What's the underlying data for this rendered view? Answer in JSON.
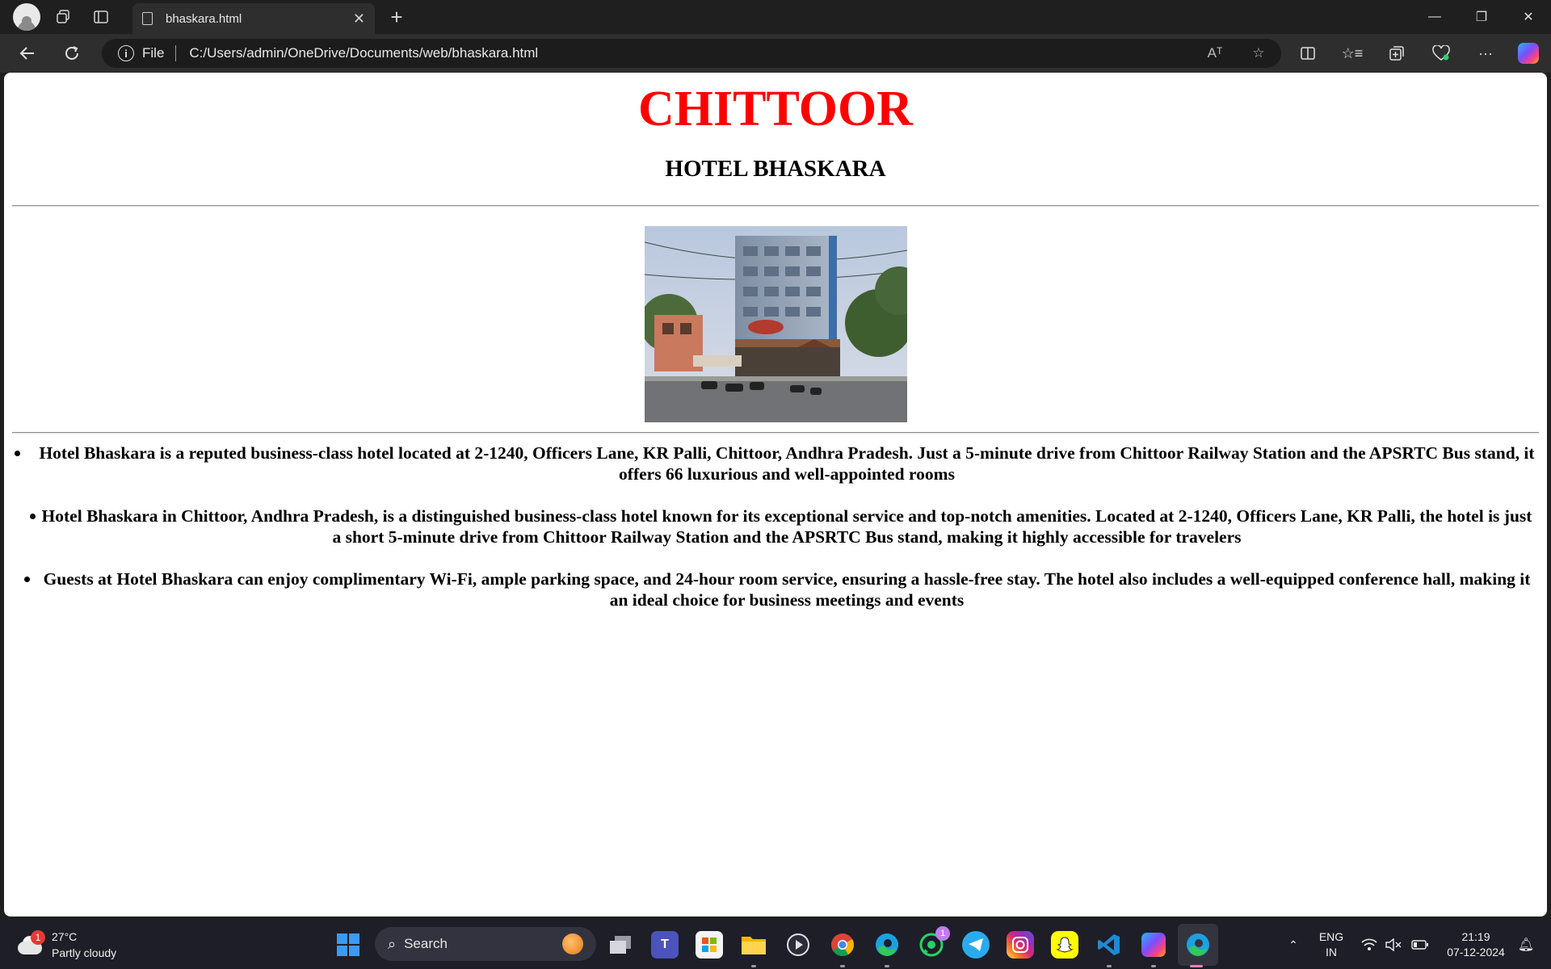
{
  "browser": {
    "tab_title": "bhaskara.html",
    "tab_close": "✕",
    "new_tab": "+",
    "address_scheme": "File",
    "address_url": "C:/Users/admin/OneDrive/Documents/web/bhaskara.html",
    "read_aloud": "Aᵀ",
    "minimize": "—",
    "restore": "❐",
    "close": "✕",
    "more": "···"
  },
  "page": {
    "city": "CHITTOOR",
    "hotel": "HOTEL BHASKARA",
    "bullets": [
      "Hotel Bhaskara is a reputed business-class hotel located at 2-1240, Officers Lane, KR Palli, Chittoor, Andhra Pradesh. Just a 5-minute drive from Chittoor Railway Station and the APSRTC Bus stand, it offers 66 luxurious and well-appointed rooms",
      "Hotel Bhaskara in Chittoor, Andhra Pradesh, is a distinguished business-class hotel known for its exceptional service and top-notch amenities. Located at 2-1240, Officers Lane, KR Palli, the hotel is just a short 5-minute drive from Chittoor Railway Station and the APSRTC Bus stand, making it highly accessible for travelers",
      "Guests at Hotel Bhaskara can enjoy complimentary Wi-Fi, ample parking space, and 24-hour room service, ensuring a hassle-free stay. The hotel also includes a well-equipped conference hall, making it an ideal choice for business meetings and events"
    ]
  },
  "taskbar": {
    "weather_temp": "27°C",
    "weather_desc": "Partly cloudy",
    "weather_badge": "1",
    "search_label": "Search",
    "whatsapp_badge": "1",
    "language_line1": "ENG",
    "language_line2": "IN",
    "time": "21:19",
    "date": "07-12-2024"
  },
  "colors": {
    "city_heading": "#ff0000",
    "chrome_bg": "#1f1f1f",
    "toolbar_bg": "#2e2e2e",
    "page_bg": "#ffffff",
    "taskbar_bg": "#1e1e28"
  },
  "icons": [
    "profile-icon",
    "workspaces-icon",
    "vertical-tabs-icon",
    "page-icon",
    "back-icon",
    "refresh-icon",
    "info-icon",
    "read-aloud-icon",
    "favorite-star-icon",
    "split-screen-icon",
    "favorites-icon",
    "collections-icon",
    "browser-essentials-icon",
    "more-icon",
    "copilot-icon",
    "weather-icon",
    "windows-start-icon",
    "search-icon",
    "task-view-icon",
    "teams-icon",
    "store-icon",
    "file-explorer-icon",
    "media-player-icon",
    "chrome-icon",
    "edge-icon",
    "whatsapp-icon",
    "telegram-icon",
    "instagram-icon",
    "snapchat-icon",
    "vscode-icon",
    "copilot-app-icon",
    "tray-chevron-icon",
    "wifi-icon",
    "volume-muted-icon",
    "battery-icon",
    "notification-bell-icon"
  ]
}
